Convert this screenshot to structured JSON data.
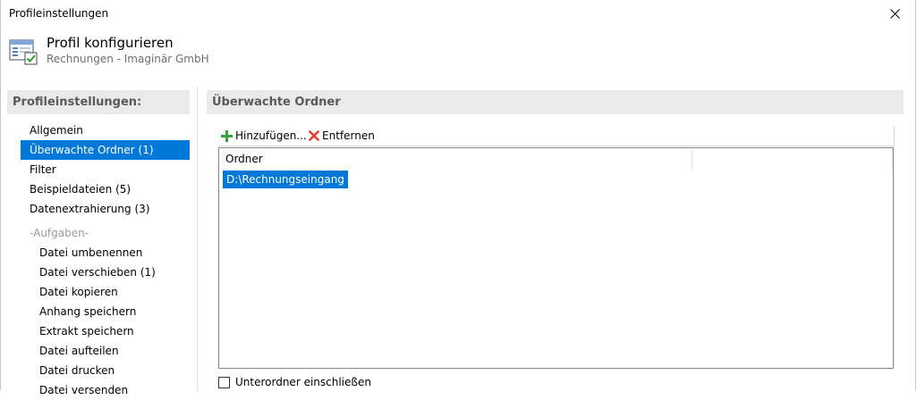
{
  "window": {
    "title": "Profileinstellungen"
  },
  "header": {
    "title": "Profil konfigurieren",
    "subtitle": "Rechnungen - Imaginär GmbH",
    "icon": "profile-window-icon"
  },
  "sidebar": {
    "heading": "Profileinstellungen:",
    "items": [
      {
        "label": "Allgemein"
      },
      {
        "label": "Überwachte Ordner (1)",
        "selected": true
      },
      {
        "label": "Filter"
      },
      {
        "label": "Beispieldateien (5)"
      },
      {
        "label": "Datenextrahierung (3)"
      }
    ],
    "group_label": "-Aufgaben-",
    "subitems": [
      {
        "label": "Datei umbenennen"
      },
      {
        "label": "Datei verschieben (1)"
      },
      {
        "label": "Datei kopieren"
      },
      {
        "label": "Anhang speichern"
      },
      {
        "label": "Extrakt speichern"
      },
      {
        "label": "Datei aufteilen"
      },
      {
        "label": "Datei drucken"
      },
      {
        "label": "Datei versenden"
      }
    ]
  },
  "content": {
    "heading": "Überwachte Ordner",
    "toolbar": {
      "add_label": "Hinzufügen...",
      "remove_label": "Entfernen"
    },
    "list": {
      "column_header": "Ordner",
      "rows": [
        "D:\\Rechnungseingang"
      ]
    },
    "checkbox_label": "Unterordner einschließen",
    "checkbox_checked": false
  },
  "colors": {
    "selection": "#0078d7",
    "add_icon": "#3aa13a",
    "remove_icon": "#e03c31"
  }
}
